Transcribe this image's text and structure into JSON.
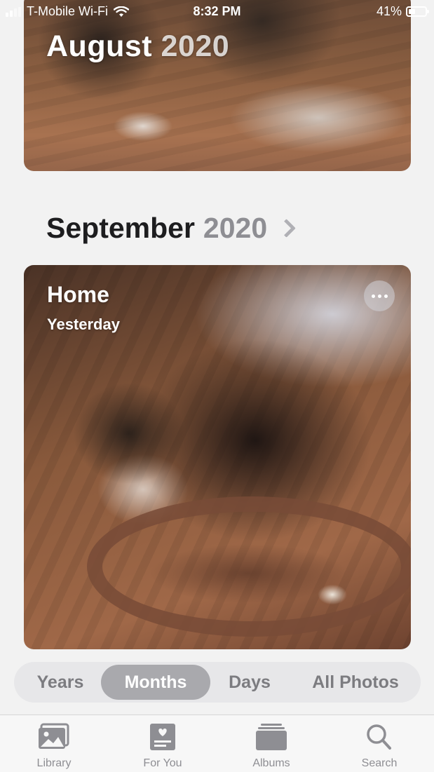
{
  "status_bar": {
    "carrier": "T-Mobile Wi-Fi",
    "time": "8:32 PM",
    "battery_percent_label": "41%",
    "battery_level": 0.41
  },
  "cards": {
    "august": {
      "month": "August",
      "year": "2020"
    },
    "september_heading": {
      "month": "September",
      "year": "2020"
    },
    "home": {
      "title": "Home",
      "subtitle": "Yesterday",
      "more_icon": "ellipsis-icon"
    }
  },
  "segmented_control": {
    "items": [
      {
        "label": "Years"
      },
      {
        "label": "Months"
      },
      {
        "label": "Days"
      },
      {
        "label": "All Photos"
      }
    ],
    "selected": "Months"
  },
  "tab_bar": {
    "items": [
      {
        "label": "Library",
        "icon": "photo-library-icon"
      },
      {
        "label": "For You",
        "icon": "for-you-icon"
      },
      {
        "label": "Albums",
        "icon": "albums-icon"
      },
      {
        "label": "Search",
        "icon": "search-icon"
      }
    ]
  },
  "colors": {
    "background": "#f2f2f2",
    "tab_inactive": "#8e8e93",
    "segment_selected": "#a9a9ad"
  }
}
